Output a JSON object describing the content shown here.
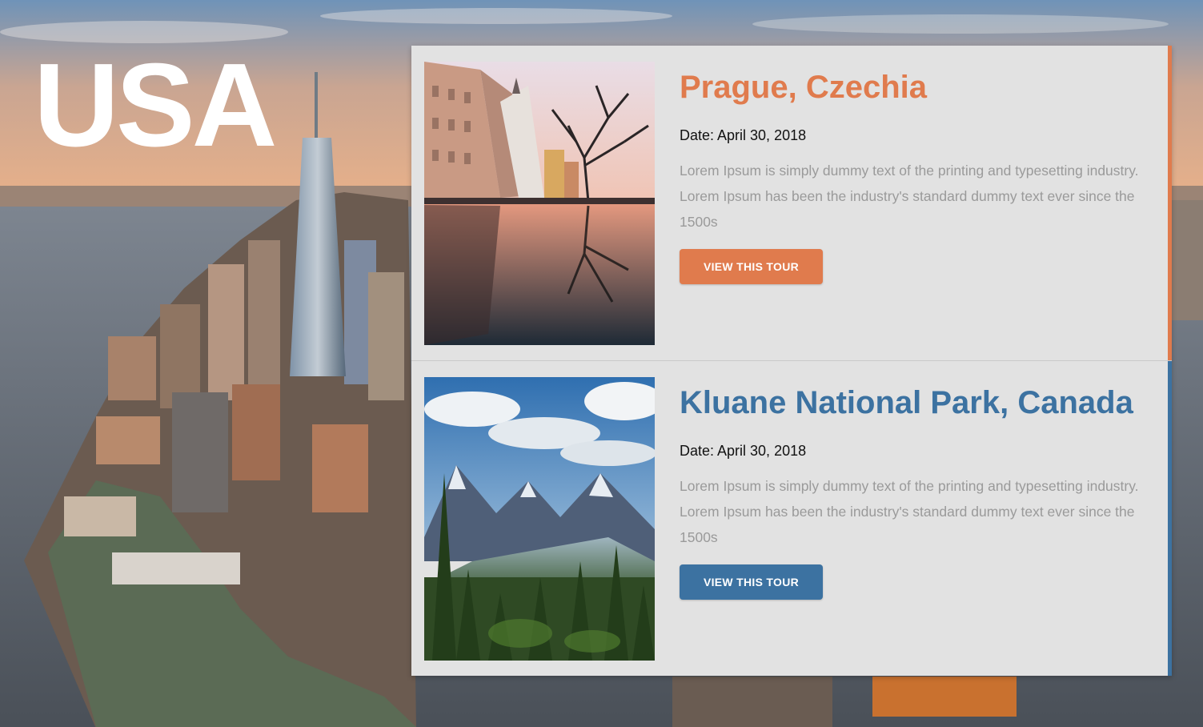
{
  "hero": {
    "title": "USA"
  },
  "tours": [
    {
      "title": "Prague, Czechia",
      "date": "Date: April 30, 2018",
      "description": "Lorem Ipsum is simply dummy text of the printing and typesetting industry. Lorem Ipsum has been the industry's standard dummy text ever since the 1500s",
      "button_label": "VIEW THIS TOUR",
      "accent_color": "#e07b4d"
    },
    {
      "title": "Kluane National Park, Canada",
      "date": "Date: April 30, 2018",
      "description": "Lorem Ipsum is simply dummy text of the printing and typesetting industry. Lorem Ipsum has been the industry's standard dummy text ever since the 1500s",
      "button_label": "VIEW THIS TOUR",
      "accent_color": "#3c72a1"
    }
  ],
  "colors": {
    "panel_background": "#e2e2e2",
    "description_text": "#9a9a9a",
    "hero_text": "#ffffff"
  }
}
